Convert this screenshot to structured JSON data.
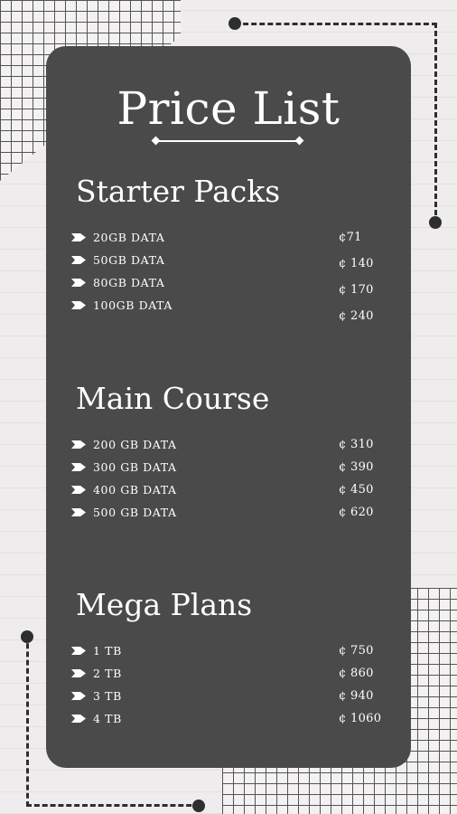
{
  "title": "Price List",
  "sections": [
    {
      "heading": "Starter Packs",
      "items": [
        {
          "label": "20GB  DATA",
          "price": "¢71"
        },
        {
          "label": "50GB  DATA",
          "price": "¢ 140"
        },
        {
          "label": "80GB  DATA",
          "price": "¢ 170"
        },
        {
          "label": "100GB  DATA",
          "price": "¢ 240"
        }
      ]
    },
    {
      "heading": "Main Course",
      "items": [
        {
          "label": "200 GB DATA",
          "price": "¢ 310"
        },
        {
          "label": "300 GB DATA",
          "price": "¢ 390"
        },
        {
          "label": "400  GB DATA",
          "price": "¢ 450"
        },
        {
          "label": "500  GB DATA",
          "price": "¢ 620"
        }
      ]
    },
    {
      "heading": "Mega Plans",
      "items": [
        {
          "label": "1  TB",
          "price": "¢ 750"
        },
        {
          "label": "2  TB",
          "price": "¢ 860"
        },
        {
          "label": "3  TB",
          "price": "¢ 940"
        },
        {
          "label": "4  TB",
          "price": "¢ 1060"
        }
      ]
    }
  ],
  "colors": {
    "card": "#4a4a4a",
    "background": "#efeced",
    "text": "#ffffff",
    "accent": "#2e2e2e"
  },
  "icons": {
    "bullet": "arrow-bullet-icon"
  }
}
